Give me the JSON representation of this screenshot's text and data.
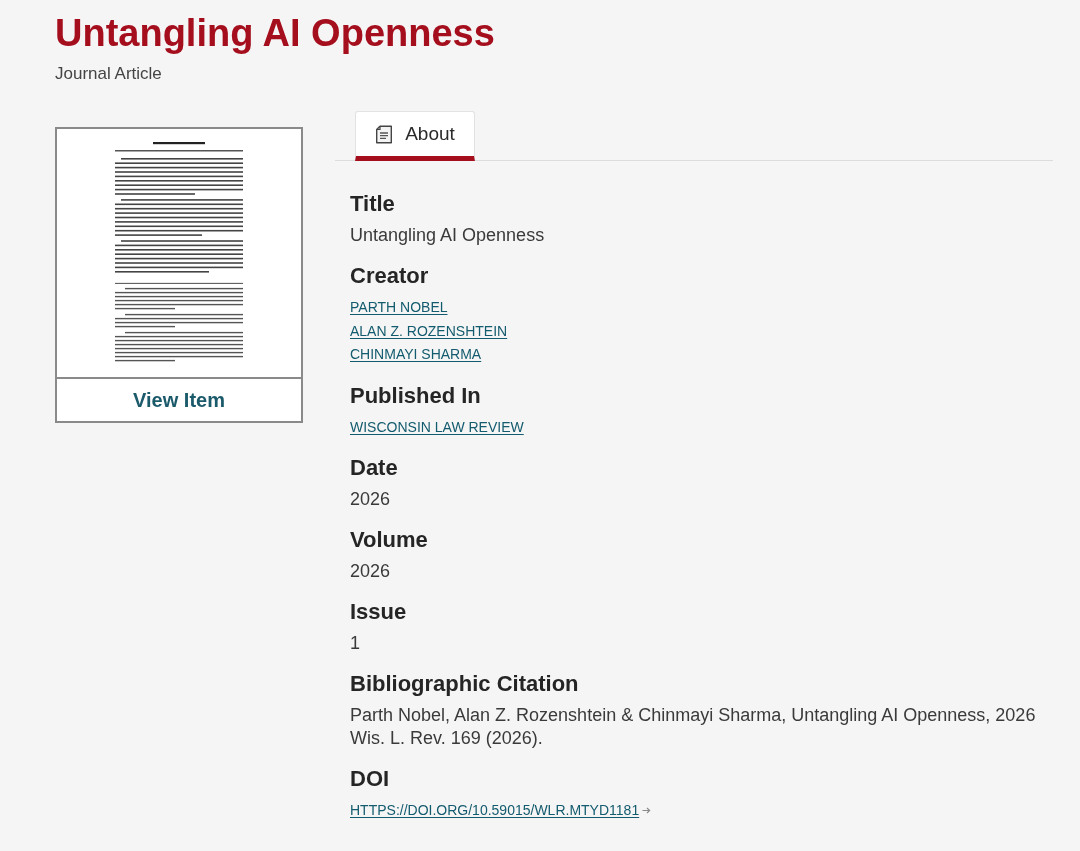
{
  "header": {
    "title": "Untangling AI Openness",
    "subtitle": "Journal Article"
  },
  "preview": {
    "button": "View Item"
  },
  "tabs": [
    {
      "label": "About",
      "selected": true
    }
  ],
  "fields": [
    {
      "label": "Title",
      "kind": "text",
      "values": [
        "Untangling AI Openness"
      ]
    },
    {
      "label": "Creator",
      "kind": "link",
      "values": [
        "PARTH NOBEL",
        "ALAN Z. ROZENSHTEIN",
        "CHINMAYI SHARMA"
      ]
    },
    {
      "label": "Published In",
      "kind": "link",
      "values": [
        "WISCONSIN LAW REVIEW"
      ]
    },
    {
      "label": "Date",
      "kind": "text",
      "values": [
        "2026"
      ]
    },
    {
      "label": "Volume",
      "kind": "text",
      "values": [
        "2026"
      ]
    },
    {
      "label": "Issue",
      "kind": "text",
      "values": [
        "1"
      ]
    },
    {
      "label": "Bibliographic Citation",
      "kind": "text",
      "values": [
        "Parth Nobel, Alan Z. Rozenshtein & Chinmayi Sharma, Untangling AI Openness, 2026 Wis. L. Rev. 169 (2026)."
      ]
    },
    {
      "label": "DOI",
      "kind": "external_link",
      "values": [
        "HTTPS://DOI.ORG/10.59015/WLR.MTYD1181"
      ]
    }
  ]
}
